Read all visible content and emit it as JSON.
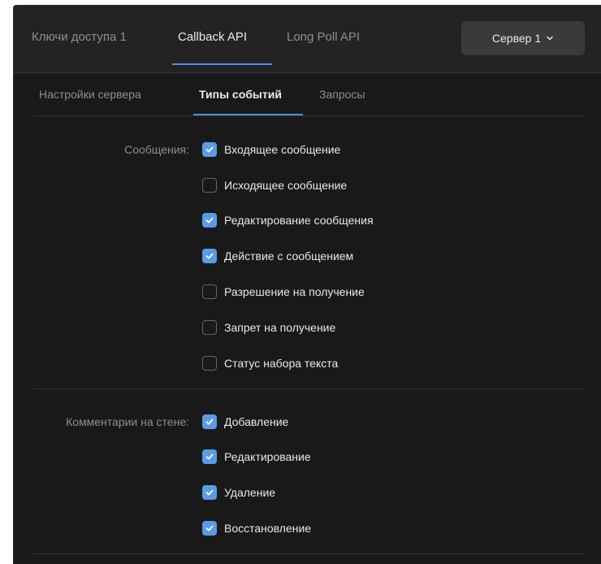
{
  "top_tabs": [
    {
      "label": "Ключи доступа 1",
      "active": false
    },
    {
      "label": "Callback API",
      "active": true
    },
    {
      "label": "Long Poll API",
      "active": false
    }
  ],
  "server_select": {
    "label": "Сервер 1"
  },
  "sub_tabs": [
    {
      "label": "Настройки сервера",
      "active": false
    },
    {
      "label": "Типы событий",
      "active": true
    },
    {
      "label": "Запросы",
      "active": false
    }
  ],
  "groups": [
    {
      "label": "Сообщения:",
      "items": [
        {
          "label": "Входящее сообщение",
          "checked": true
        },
        {
          "label": "Исходящее сообщение",
          "checked": false
        },
        {
          "label": "Редактирование сообщения",
          "checked": true
        },
        {
          "label": "Действие с сообщением",
          "checked": true
        },
        {
          "label": "Разрешение на получение",
          "checked": false
        },
        {
          "label": "Запрет на получение",
          "checked": false
        },
        {
          "label": "Статус набора текста",
          "checked": false
        }
      ]
    },
    {
      "label": "Комментарии на стене:",
      "items": [
        {
          "label": "Добавление",
          "checked": true
        },
        {
          "label": "Редактирование",
          "checked": true
        },
        {
          "label": "Удаление",
          "checked": true
        },
        {
          "label": "Восстановление",
          "checked": true
        }
      ]
    }
  ],
  "colors": {
    "accent": "#4f8ee6",
    "checkbox_checked": "#5a9be8",
    "background": "#19191a"
  }
}
